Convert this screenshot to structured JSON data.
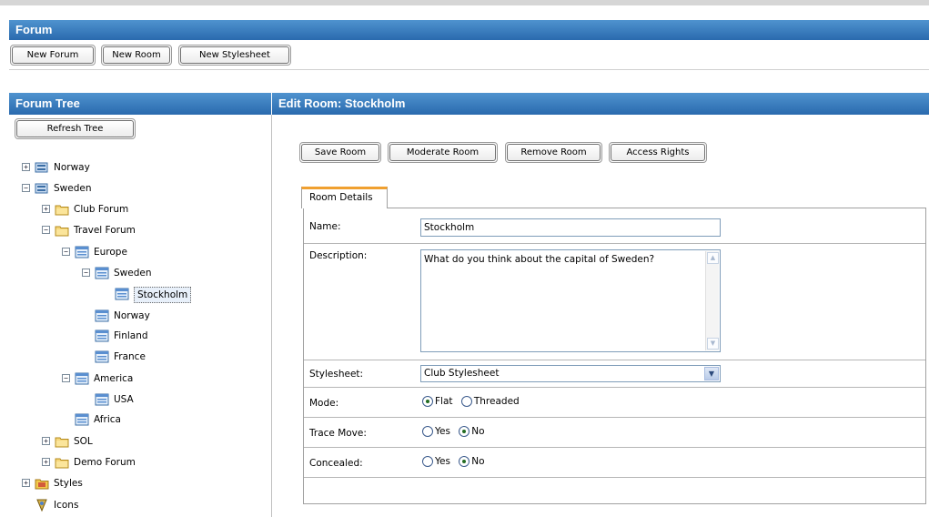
{
  "forum_header": {
    "title": "Forum"
  },
  "toolbar": {
    "new_forum": "New Forum",
    "new_room": "New Room",
    "new_stylesheet": "New Stylesheet"
  },
  "tree_panel": {
    "title": "Forum Tree",
    "refresh_label": "Refresh Tree"
  },
  "tree": [
    {
      "label": "Norway",
      "toggle": "+",
      "icon": "forum-icon"
    },
    {
      "label": "Sweden",
      "toggle": "-",
      "icon": "forum-icon"
    },
    {
      "label": "Club Forum",
      "toggle": "+",
      "icon": "folder-icon"
    },
    {
      "label": "Travel Forum",
      "toggle": "-",
      "icon": "folder-icon"
    },
    {
      "label": "Europe",
      "toggle": "-",
      "icon": "room-icon"
    },
    {
      "label": "Sweden",
      "toggle": "-",
      "icon": "room-icon"
    },
    {
      "label": "Stockholm",
      "toggle": "",
      "icon": "room-icon"
    },
    {
      "label": "Norway",
      "toggle": "",
      "icon": "room-icon"
    },
    {
      "label": "Finland",
      "toggle": "",
      "icon": "room-icon"
    },
    {
      "label": "France",
      "toggle": "",
      "icon": "room-icon"
    },
    {
      "label": "America",
      "toggle": "-",
      "icon": "room-icon"
    },
    {
      "label": "USA",
      "toggle": "",
      "icon": "room-icon"
    },
    {
      "label": "Africa",
      "toggle": "",
      "icon": "room-icon"
    },
    {
      "label": "SOL",
      "toggle": "+",
      "icon": "folder-icon"
    },
    {
      "label": "Demo Forum",
      "toggle": "+",
      "icon": "folder-icon"
    },
    {
      "label": "Styles",
      "toggle": "+",
      "icon": "styles-folder-icon"
    },
    {
      "label": "Icons",
      "toggle": "",
      "icon": "icons-icon"
    }
  ],
  "edit_panel": {
    "title": "Edit Room: Stockholm"
  },
  "actions": {
    "save": "Save Room",
    "moderate": "Moderate Room",
    "remove": "Remove Room",
    "access": "Access Rights"
  },
  "tab": {
    "label": "Room Details"
  },
  "form": {
    "name_label": "Name:",
    "name_value": "Stockholm",
    "description_label": "Description:",
    "description_value": "What do you think about the capital of Sweden?",
    "stylesheet_label": "Stylesheet:",
    "stylesheet_value": "Club Stylesheet",
    "mode_label": "Mode:",
    "mode_flat": "Flat",
    "mode_threaded": "Threaded",
    "mode_selected": "Flat",
    "trace_label": "Trace Move:",
    "trace_yes": "Yes",
    "trace_no": "No",
    "trace_selected": "No",
    "concealed_label": "Concealed:",
    "concealed_yes": "Yes",
    "concealed_no": "No",
    "concealed_selected": "No"
  },
  "colors": {
    "header_top": "#4f93cf",
    "header_bottom": "#2a6aae",
    "tab_accent": "#f0a030",
    "radio_dot": "#236c22"
  }
}
